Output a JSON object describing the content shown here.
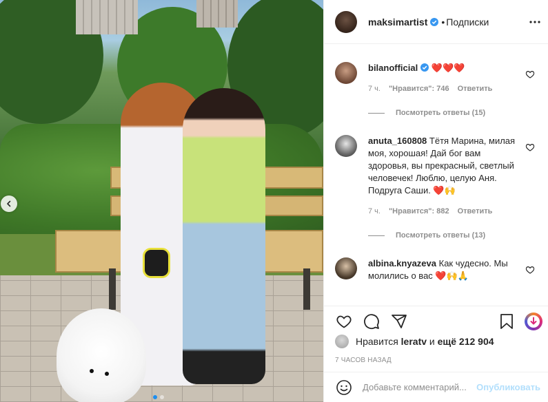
{
  "post": {
    "author": "maksimartist",
    "separator": "•",
    "follow_status": "Подписки",
    "colors": {
      "verified": "#3897f0",
      "accent_link": "#b2dffc",
      "muted": "#8e8e8e"
    }
  },
  "carousel": {
    "total": 2,
    "active_index": 0
  },
  "comments": [
    {
      "user": "bilanofficial",
      "verified": true,
      "text": "❤️❤️❤️",
      "time": "7 ч.",
      "likes": "\"Нравится\": 746",
      "reply": "Ответить",
      "view_replies": "Посмотреть ответы (15)"
    },
    {
      "user": "anuta_160808",
      "verified": false,
      "text": "Тётя Марина, милая моя, хорошая! Дай бог вам здоровья, вы прекрасный, светлый человечек! Люблю, целую Аня. Подруга Саши. ❤️🙌",
      "time": "7 ч.",
      "likes": "\"Нравится\": 882",
      "reply": "Ответить",
      "view_replies": "Посмотреть ответы (13)"
    },
    {
      "user": "albina.knyazeva",
      "verified": false,
      "text": "Как чудесно. Мы молились о вас ❤️🙌🙏"
    }
  ],
  "likes": {
    "prefix": "Нравится",
    "user": "leratv",
    "middle": "и",
    "count": "ещё 212 904"
  },
  "timestamp": "7 ЧАСОВ НАЗАД",
  "add_comment": {
    "placeholder": "Добавьте комментарий...",
    "publish": "Опубликовать"
  },
  "icons": {
    "more": "more-horizontal-icon",
    "like": "heart-icon",
    "comment": "comment-icon",
    "share": "paper-plane-icon",
    "save": "bookmark-icon",
    "emoji": "smiley-icon",
    "prev": "chevron-left-icon"
  }
}
